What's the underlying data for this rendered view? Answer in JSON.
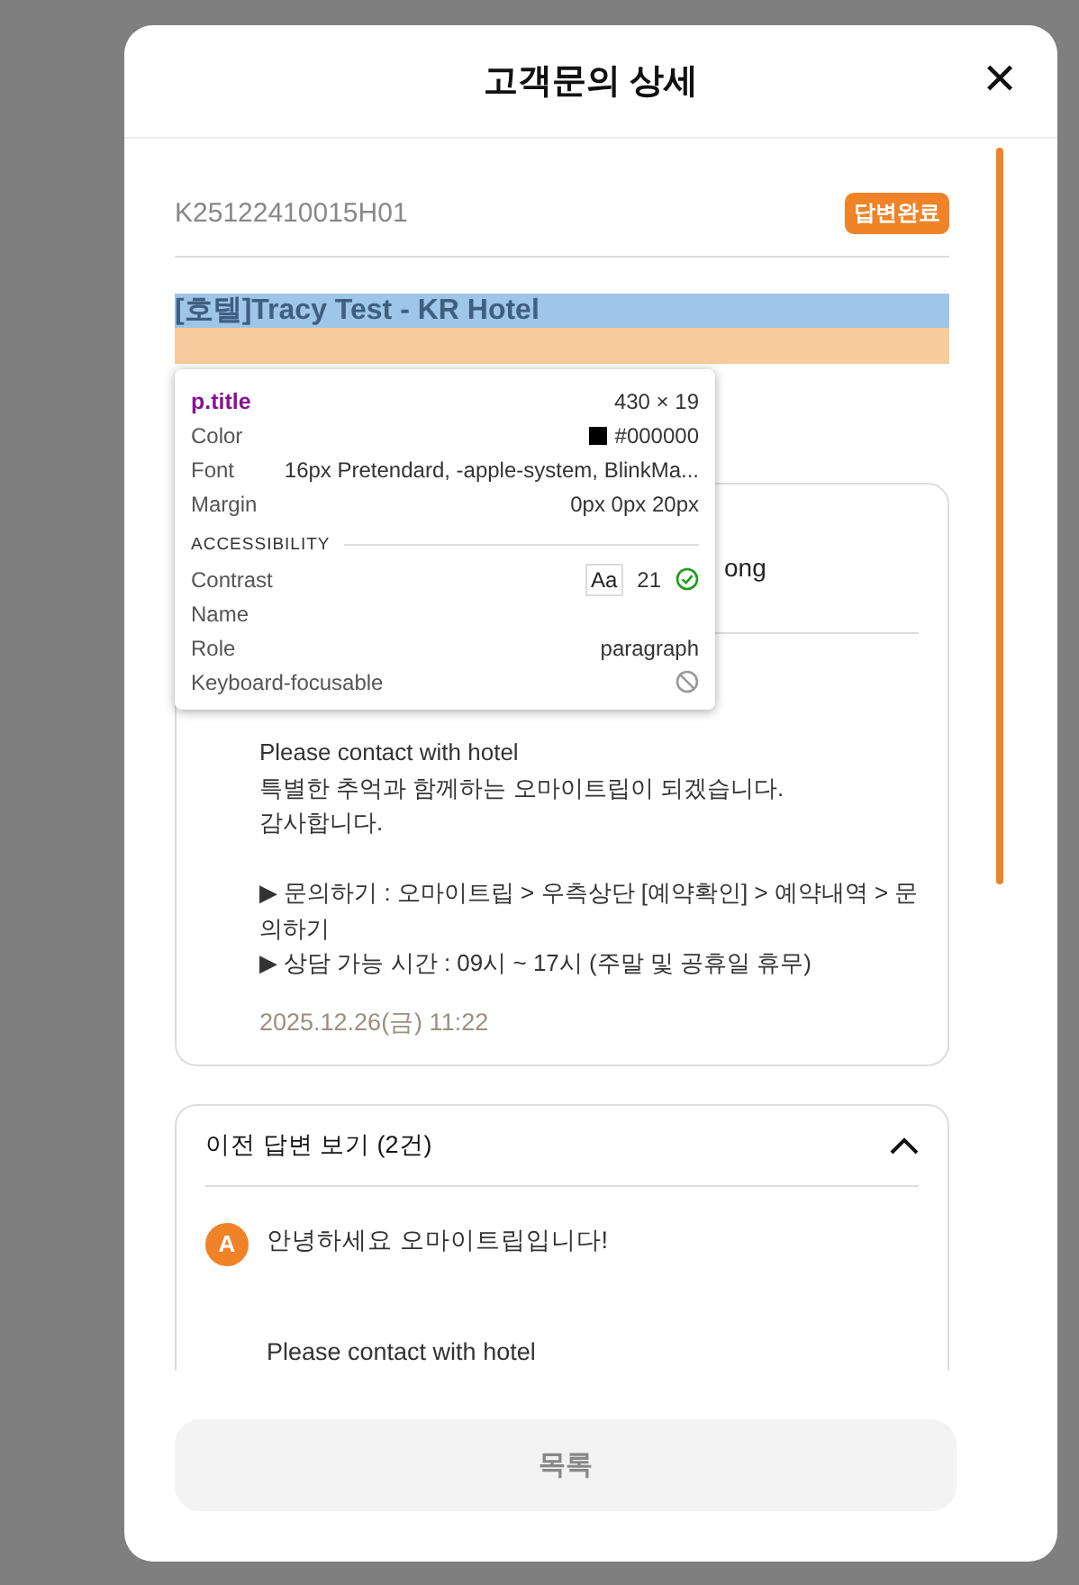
{
  "modal": {
    "title": "고객문의 상세",
    "close_label": "✕"
  },
  "inquiry": {
    "number": "K25122410015H01",
    "status": "답변완료",
    "title": "[호텔]Tracy Test - KR Hotel"
  },
  "answer": {
    "partial_text": "ong",
    "paragraphs": [
      [
        "Please contact with hotel",
        "특별한 추억과 함께하는 오마이트립이 되겠습니다.",
        "감사합니다."
      ],
      [
        "▶ 문의하기 : 오마이트립 > 우측상단 [예약확인] > 예약내역 > 문의하기",
        "▶ 상담 가능 시간 : 09시 ~ 17시 (주말 및 공휴일 휴무)"
      ]
    ],
    "date": "2025.12.26(금) 11:22"
  },
  "previous": {
    "title": "이전 답변 보기 (2건)",
    "expanded": true,
    "avatar": "A",
    "greeting": "안녕하세요 오마이트립입니다!",
    "lines": [
      "Please contact with hotel"
    ]
  },
  "list_button": "목록",
  "inspector": {
    "selector": "p.title",
    "size": "430 × 19",
    "rows": [
      {
        "label": "Color",
        "value": "#000000",
        "kind": "swatch"
      },
      {
        "label": "Font",
        "value": "16px Pretendard, -apple-system, BlinkMa...",
        "kind": "text"
      },
      {
        "label": "Margin",
        "value": "0px 0px 20px",
        "kind": "text"
      }
    ],
    "section": "ACCESSIBILITY",
    "a11y": [
      {
        "label": "Contrast",
        "kind": "contrast",
        "badge": "Aa",
        "value": "21"
      },
      {
        "label": "Name",
        "kind": "empty"
      },
      {
        "label": "Role",
        "kind": "text",
        "value": "paragraph"
      },
      {
        "label": "Keyboard-focusable",
        "kind": "blocked"
      }
    ]
  }
}
